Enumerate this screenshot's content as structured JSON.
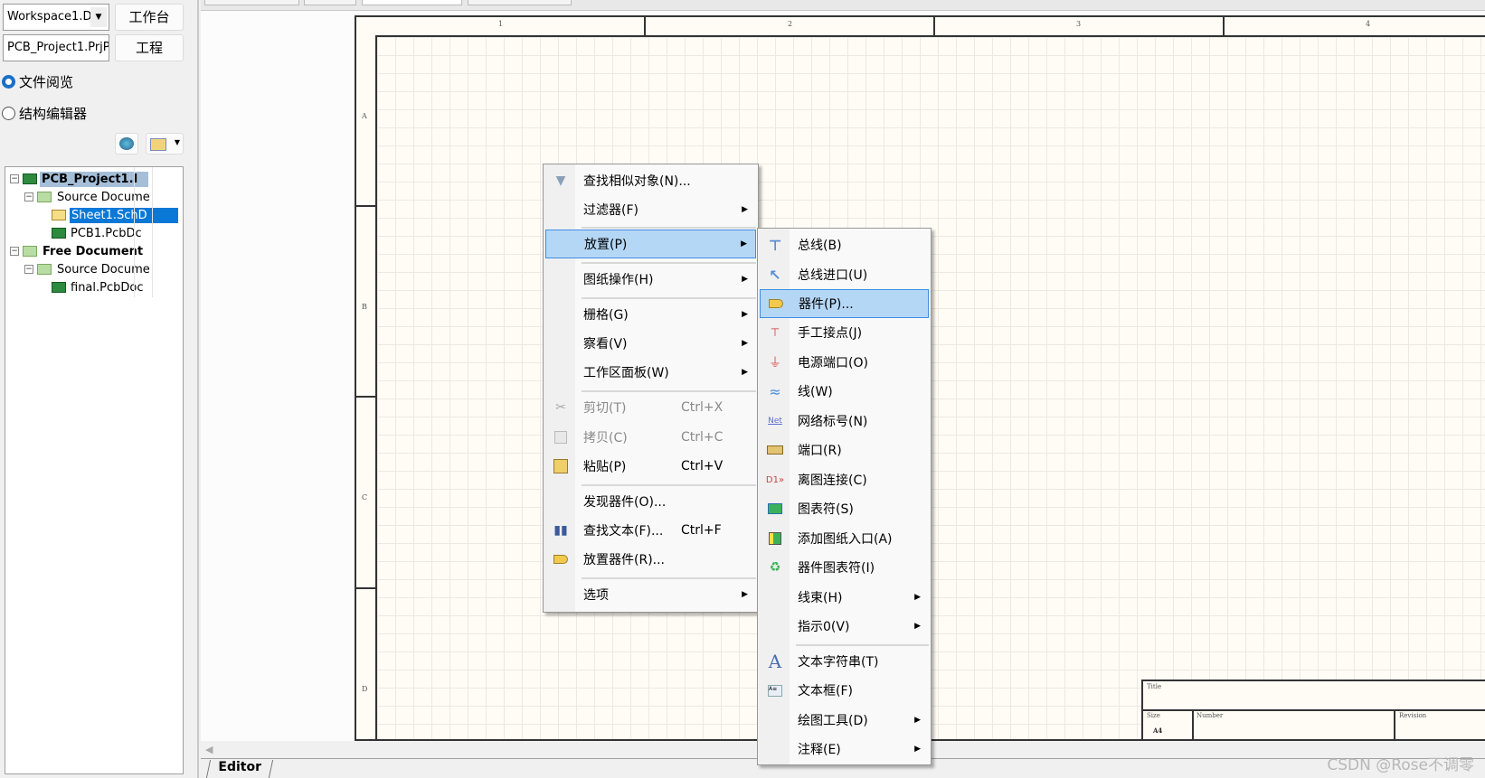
{
  "left_panel": {
    "workspace_combo": "Workspace1.D",
    "workspace_button": "工作台",
    "project_combo": "PCB_Project1.PrjPC",
    "project_button": "工程",
    "radio_file_browse": {
      "label": "文件阅览",
      "checked": true
    },
    "radio_structure_editor": {
      "label": "结构编辑器",
      "checked": false
    },
    "tree": [
      {
        "label": "PCB_Project1.I",
        "level": 0,
        "bold": true,
        "icon": "project-icon",
        "expanded": true
      },
      {
        "label": "Source Docume",
        "level": 1,
        "icon": "folder-icon",
        "expanded": true
      },
      {
        "label": "Sheet1.SchD",
        "level": 2,
        "icon": "schematic-doc-icon",
        "selected": true
      },
      {
        "label": "PCB1.PcbDc",
        "level": 2,
        "icon": "pcb-doc-icon"
      },
      {
        "label": "Free Document",
        "level": 0,
        "bold": true,
        "icon": "folder-icon",
        "expanded": true
      },
      {
        "label": "Source Docume",
        "level": 1,
        "icon": "folder-icon",
        "expanded": true
      },
      {
        "label": "final.PcbDoc",
        "level": 2,
        "icon": "pcb-doc-icon"
      }
    ]
  },
  "sheet": {
    "columns": [
      "1",
      "2",
      "3",
      "4"
    ],
    "rows": [
      "A",
      "B",
      "C",
      "D"
    ],
    "title_block": {
      "title_label": "Title",
      "size_label": "Size",
      "size_value": "A4",
      "number_label": "Number",
      "revision_label": "Revision"
    }
  },
  "editor_tab": "Editor",
  "context_menu": [
    {
      "label": "查找相似对象(N)...",
      "icon": "filter-icon"
    },
    {
      "label": "过滤器(F)",
      "submenu": true
    },
    {
      "label": "放置(P)",
      "submenu": true,
      "highlighted": true
    },
    {
      "label": "图纸操作(H)",
      "submenu": true
    },
    {
      "label": "栅格(G)",
      "submenu": true
    },
    {
      "label": "察看(V)",
      "submenu": true
    },
    {
      "label": "工作区面板(W)",
      "submenu": true
    },
    {
      "label": "剪切(T)",
      "shortcut": "Ctrl+X",
      "disabled": true,
      "icon": "scissors-icon"
    },
    {
      "label": "拷贝(C)",
      "shortcut": "Ctrl+C",
      "disabled": true,
      "icon": "copy-icon"
    },
    {
      "label": "粘贴(P)",
      "shortcut": "Ctrl+V",
      "icon": "paste-icon"
    },
    {
      "label": "发现器件(O)..."
    },
    {
      "label": "查找文本(F)...",
      "shortcut": "Ctrl+F",
      "icon": "binoculars-icon"
    },
    {
      "label": "放置器件(R)...",
      "icon": "component-icon"
    },
    {
      "label": "选项",
      "submenu": true
    }
  ],
  "place_submenu": [
    {
      "label": "总线(B)",
      "icon": "bus-icon"
    },
    {
      "label": "总线进口(U)",
      "icon": "bus-entry-icon"
    },
    {
      "label": "器件(P)...",
      "icon": "component-icon",
      "highlighted": true
    },
    {
      "label": "手工接点(J)",
      "icon": "junction-icon"
    },
    {
      "label": "电源端口(O)",
      "icon": "power-port-icon"
    },
    {
      "label": "线(W)",
      "icon": "wire-icon"
    },
    {
      "label": "网络标号(N)",
      "icon": "net-label-icon"
    },
    {
      "label": "端口(R)",
      "icon": "port-icon"
    },
    {
      "label": "离图连接(C)",
      "icon": "off-sheet-connector-icon"
    },
    {
      "label": "图表符(S)",
      "icon": "sheet-symbol-icon"
    },
    {
      "label": "添加图纸入口(A)",
      "icon": "sheet-entry-icon"
    },
    {
      "label": "器件图表符(I)",
      "icon": "device-sheet-symbol-icon"
    },
    {
      "label": "线束(H)",
      "submenu": true
    },
    {
      "label": "指示0(V)",
      "submenu": true
    },
    {
      "label": "文本字符串(T)",
      "icon": "text-string-icon"
    },
    {
      "label": "文本框(F)",
      "icon": "text-frame-icon"
    },
    {
      "label": "绘图工具(D)",
      "submenu": true
    },
    {
      "label": "注释(E)",
      "submenu": true
    }
  ],
  "watermark": "CSDN @Rose不调零",
  "colors": {
    "highlight": "#b5d7f6",
    "selection": "#0a78d7",
    "accent": "#1a6fc9"
  }
}
